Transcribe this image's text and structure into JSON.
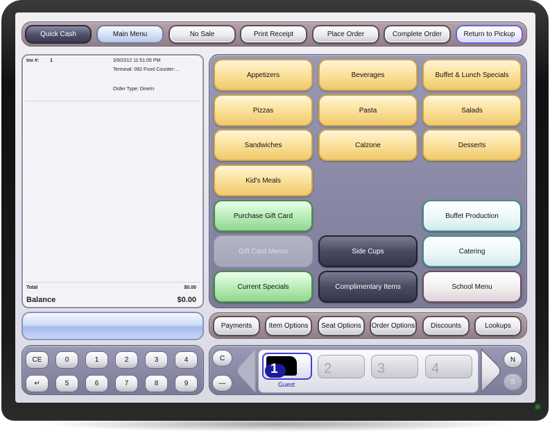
{
  "toolbar": {
    "buttons": [
      "Quick Cash",
      "Main Menu",
      "No Sale",
      "Print Receipt",
      "Place Order",
      "Complete Order",
      "Return to Pickup"
    ]
  },
  "receipt": {
    "inv_label": "Inv #:",
    "inv_number": "1",
    "datetime": "3/9/2012 11:51:05 PM",
    "terminal": "Terminal: 092 Front Counter-...",
    "order_type": "Order Type: DineIn",
    "total_label": "Total",
    "total_value": "$0.00",
    "balance_label": "Balance",
    "balance_value": "$0.00"
  },
  "categories": {
    "appetizers": "Appetizers",
    "beverages": "Beverages",
    "buffet_lunch": "Buffet & Lunch Specials",
    "pizzas": "Pizzas",
    "pasta": "Pasta",
    "salads": "Salads",
    "sandwiches": "Sandwiches",
    "calzone": "Calzone",
    "desserts": "Desserts",
    "kids_meals": "Kid's Meals",
    "purchase_gift_card": "Purchase Gift Card",
    "buffet_production": "Buffet Production",
    "gift_card_memo": "Gift Card Memo",
    "side_cups": "Side Cups",
    "catering": "Catering",
    "current_specials": "Current Specials",
    "complimentary_items": "Complimentary Items",
    "school_menu": "School Menu"
  },
  "actions": {
    "buttons": [
      "Payments",
      "Item Options",
      "Seat Options",
      "Order Options",
      "Discounts",
      "Lookups"
    ]
  },
  "keypad": {
    "top_row": [
      "CE",
      "0",
      "1",
      "2",
      "3",
      "4"
    ],
    "bottom_row": [
      "↵",
      "5",
      "6",
      "7",
      "8",
      "9"
    ]
  },
  "seats": {
    "clear_label": "C",
    "minus_label": "—",
    "active_seat": "1",
    "active_label": "Guest",
    "other_seats": [
      "2",
      "3",
      "4"
    ],
    "n_label": "N",
    "s_label": "S"
  }
}
